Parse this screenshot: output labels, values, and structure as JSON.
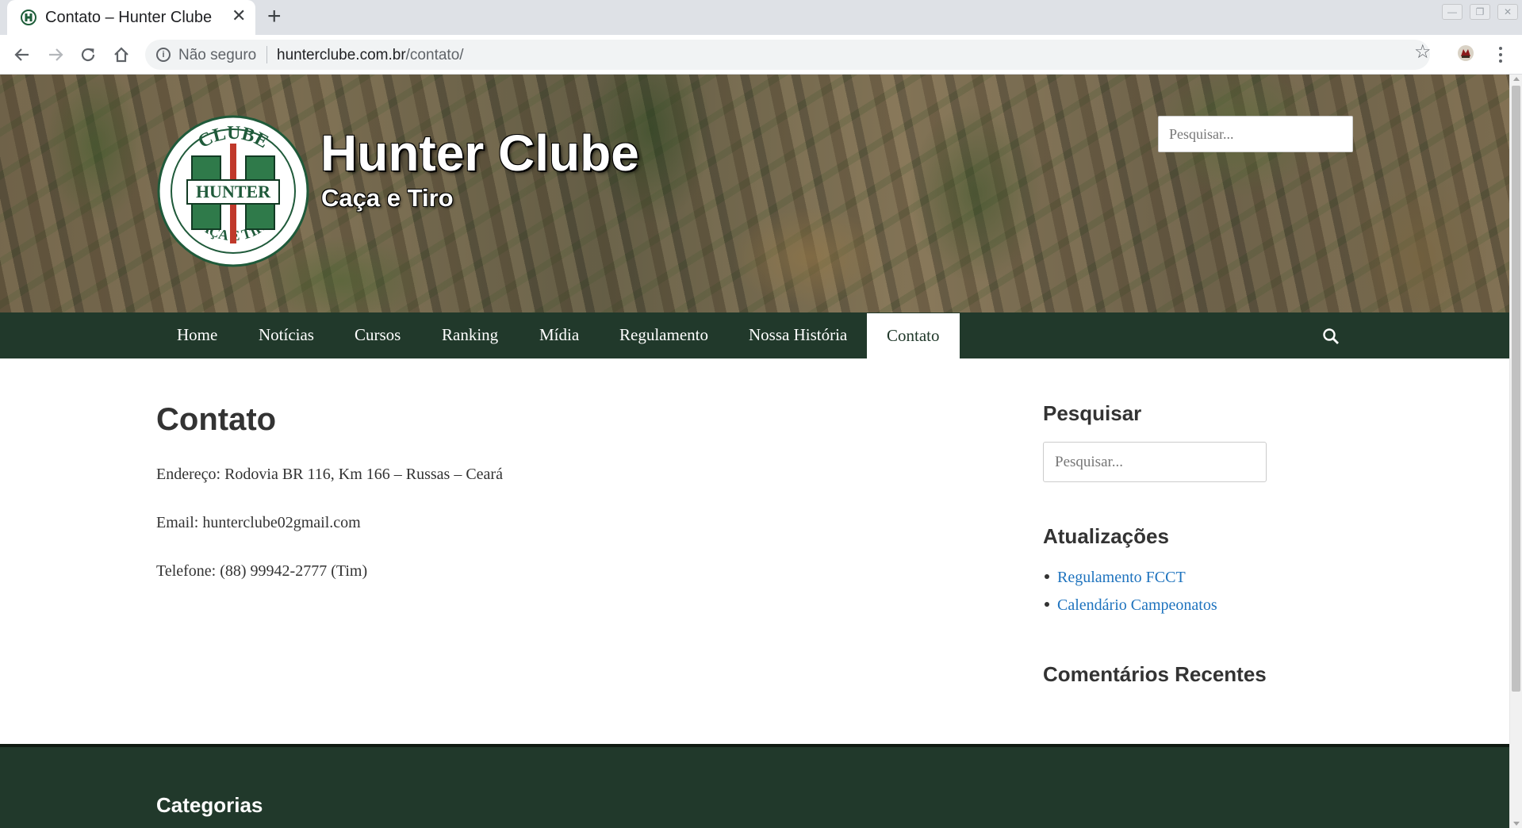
{
  "browser": {
    "tab_title": "Contato – Hunter Clube",
    "tab_close": "✕",
    "new_tab": "+",
    "security_label": "Não seguro",
    "url_host": "hunterclube.com.br",
    "url_path": "/contato/",
    "window_controls": [
      "—",
      "❐",
      "✕"
    ]
  },
  "header": {
    "site_title": "Hunter Clube",
    "tagline": "Caça e Tiro",
    "search_placeholder": "Pesquisar...",
    "logo_text_top": "CLUBE",
    "logo_text_middle": "HUNTER",
    "logo_text_bottom": "CAÇA E TIRO"
  },
  "nav": {
    "items": [
      "Home",
      "Notícias",
      "Cursos",
      "Ranking",
      "Mídia",
      "Regulamento",
      "Nossa História",
      "Contato"
    ],
    "active": "Contato"
  },
  "main": {
    "title": "Contato",
    "lines": [
      "Endereço: Rodovia BR 116, Km 166 – Russas – Ceará",
      "Email: hunterclube02gmail.com",
      "Telefone: (88) 99942-2777 (Tim)"
    ]
  },
  "sidebar": {
    "search_title": "Pesquisar",
    "search_placeholder": "Pesquisar...",
    "updates_title": "Atualizações",
    "updates": [
      "Regulamento FCCT",
      "Calendário Campeonatos"
    ],
    "comments_title": "Comentários Recentes"
  },
  "footer": {
    "categories_title": "Categorias"
  },
  "colors": {
    "nav_bg": "#21392b",
    "link": "#1e73be",
    "text": "#333333"
  },
  "icons": [
    "back-arrow-icon",
    "forward-arrow-icon",
    "reload-icon",
    "home-icon",
    "info-icon",
    "star-icon",
    "extension-icon",
    "menu-icon",
    "search-icon"
  ]
}
